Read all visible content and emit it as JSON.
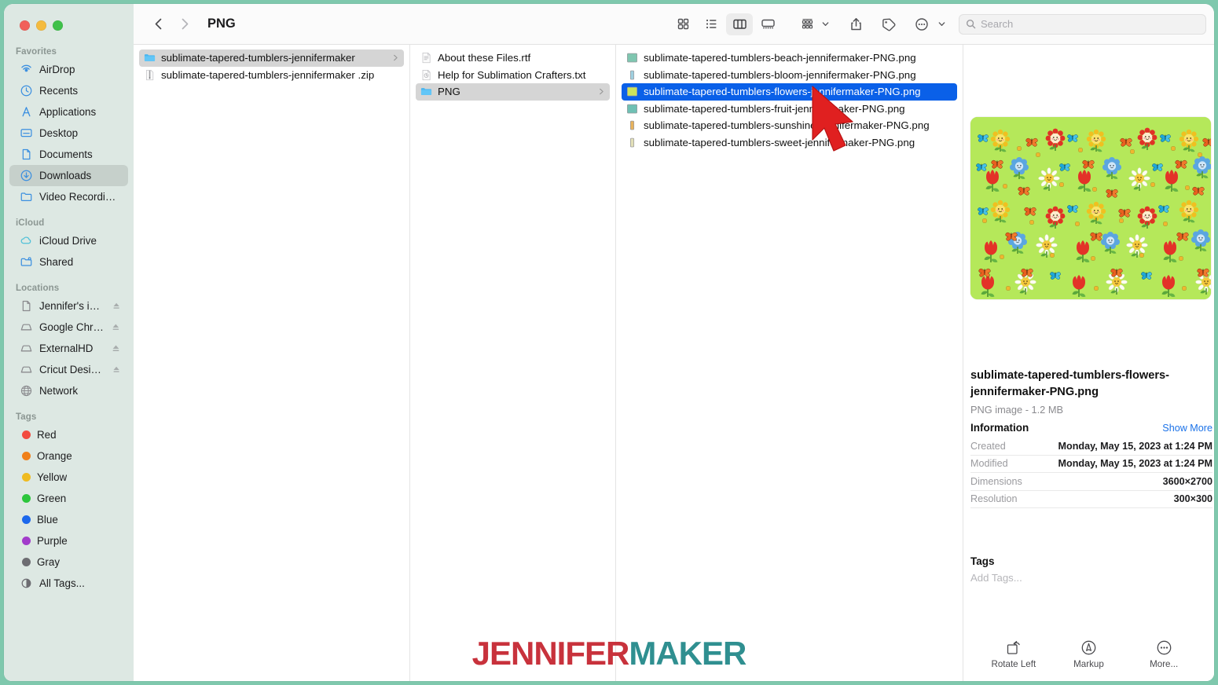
{
  "window": {
    "title": "PNG",
    "traffic_lights": [
      "close-red",
      "minimize-yellow",
      "zoom-green"
    ]
  },
  "toolbar": {
    "back_icon": "chevron-left-icon",
    "forward_icon": "chevron-right-icon",
    "path_title": "PNG",
    "views": [
      {
        "name": "icon-view",
        "icon": "grid-icon",
        "active": false
      },
      {
        "name": "list-view",
        "icon": "list-icon",
        "active": false
      },
      {
        "name": "column-view",
        "icon": "columns-icon",
        "active": true
      },
      {
        "name": "gallery-view",
        "icon": "gallery-icon",
        "active": false
      }
    ],
    "group_icon": "group-by-icon",
    "share_icon": "share-icon",
    "tag_icon": "tag-icon",
    "more_icon": "more-ellipsis-icon"
  },
  "search": {
    "placeholder": "Search",
    "value": "",
    "icon": "search-icon"
  },
  "sidebar": {
    "sections": [
      {
        "label": "Favorites",
        "items": [
          {
            "label": "AirDrop",
            "icon": "airdrop-icon",
            "selected": false
          },
          {
            "label": "Recents",
            "icon": "clock-icon",
            "selected": false
          },
          {
            "label": "Applications",
            "icon": "applications-icon",
            "selected": false
          },
          {
            "label": "Desktop",
            "icon": "desktop-icon",
            "selected": false
          },
          {
            "label": "Documents",
            "icon": "document-icon",
            "selected": false
          },
          {
            "label": "Downloads",
            "icon": "downloads-icon",
            "selected": true
          },
          {
            "label": "Video Recordings",
            "icon": "folder-icon",
            "selected": false
          }
        ]
      },
      {
        "label": "iCloud",
        "items": [
          {
            "label": "iCloud Drive",
            "icon": "cloud-icon",
            "selected": false
          },
          {
            "label": "Shared",
            "icon": "shared-folder-icon",
            "selected": false
          }
        ]
      },
      {
        "label": "Locations",
        "items": [
          {
            "label": "Jennifer's iPh...",
            "icon": "iphone-icon",
            "eject": true,
            "selected": false
          },
          {
            "label": "Google Chro...",
            "icon": "disk-icon",
            "eject": true,
            "selected": false
          },
          {
            "label": "ExternalHD",
            "icon": "disk-icon",
            "eject": true,
            "selected": false
          },
          {
            "label": "Cricut Design...",
            "icon": "disk-icon",
            "eject": true,
            "selected": false
          },
          {
            "label": "Network",
            "icon": "globe-icon",
            "eject": false,
            "selected": false
          }
        ]
      },
      {
        "label": "Tags",
        "items": [
          {
            "label": "Red",
            "color": "#f24b3f",
            "icon": "tag-dot-icon"
          },
          {
            "label": "Orange",
            "color": "#f08019",
            "icon": "tag-dot-icon"
          },
          {
            "label": "Yellow",
            "color": "#efbb21",
            "icon": "tag-dot-icon"
          },
          {
            "label": "Green",
            "color": "#2cc63c",
            "icon": "tag-dot-icon"
          },
          {
            "label": "Blue",
            "color": "#1c68ec",
            "icon": "tag-dot-icon"
          },
          {
            "label": "Purple",
            "color": "#a23ccb",
            "icon": "tag-dot-icon"
          },
          {
            "label": "Gray",
            "color": "#6d6d72",
            "icon": "tag-dot-icon"
          },
          {
            "label": "All Tags...",
            "icon": "all-tags-icon"
          }
        ]
      }
    ]
  },
  "columns": [
    {
      "name": "column-1",
      "items": [
        {
          "label": "sublimate-tapered-tumblers-jennifermaker",
          "icon": "folder-icon",
          "selected": true,
          "chevron": true
        },
        {
          "label": "sublimate-tapered-tumblers-jennifermaker .zip",
          "icon": "zip-icon",
          "selected": false,
          "chevron": false
        }
      ]
    },
    {
      "name": "column-2",
      "items": [
        {
          "label": "About these Files.rtf",
          "icon": "rtf-icon",
          "selected": false,
          "chevron": false
        },
        {
          "label": "Help for Sublimation Crafters.txt",
          "icon": "txt-icon",
          "selected": false,
          "chevron": false
        },
        {
          "label": "PNG",
          "icon": "folder-icon",
          "selected": true,
          "chevron": true
        }
      ]
    },
    {
      "name": "column-3",
      "items": [
        {
          "label": "sublimate-tapered-tumblers-beach-jennifermaker-PNG.png",
          "icon": "png-thumb-icon",
          "thumb": "#7fc6b0",
          "selected": false,
          "chevron": false,
          "wide": true
        },
        {
          "label": "sublimate-tapered-tumblers-bloom-jennifermaker-PNG.png",
          "icon": "png-thumb-icon",
          "thumb": "#9fd0e0",
          "selected": false,
          "chevron": false,
          "wide": false
        },
        {
          "label": "sublimate-tapered-tumblers-flowers-jennifermaker-PNG.png",
          "icon": "png-thumb-icon",
          "thumb": "#cbe45c",
          "selected": true,
          "chevron": false,
          "wide": true
        },
        {
          "label": "sublimate-tapered-tumblers-fruit-jennifermaker-PNG.png",
          "icon": "png-thumb-icon",
          "thumb": "#6fc0b4",
          "selected": false,
          "chevron": false,
          "wide": true
        },
        {
          "label": "sublimate-tapered-tumblers-sunshine-jennifermaker-PNG.png",
          "icon": "png-thumb-icon",
          "thumb": "#e8b35c",
          "selected": false,
          "chevron": false,
          "wide": false
        },
        {
          "label": "sublimate-tapered-tumblers-sweet-jennifermaker-PNG.png",
          "icon": "png-thumb-icon",
          "thumb": "#e3e0b8",
          "selected": false,
          "chevron": false,
          "wide": false
        }
      ]
    }
  ],
  "preview": {
    "thumbnail_alt": "green floral pattern with kawaii flowers and butterflies",
    "thumbnail_bg": "#b5e85a",
    "filename": "sublimate-tapered-tumblers-flowers-jennifermaker-PNG.png",
    "kind_and_size": "PNG image - 1.2 MB",
    "information_label": "Information",
    "show_more_label": "Show More",
    "rows": [
      {
        "key": "Created",
        "value": "Monday, May 15, 2023 at 1:24 PM"
      },
      {
        "key": "Modified",
        "value": "Monday, May 15, 2023 at 1:24 PM"
      },
      {
        "key": "Dimensions",
        "value": "3600×2700"
      },
      {
        "key": "Resolution",
        "value": "300×300"
      }
    ],
    "tags_label": "Tags",
    "add_tags_placeholder": "Add Tags...",
    "actions": [
      {
        "label": "Rotate Left",
        "icon": "rotate-left-icon"
      },
      {
        "label": "Markup",
        "icon": "markup-icon"
      },
      {
        "label": "More...",
        "icon": "more-ellipsis-icon"
      }
    ]
  },
  "watermark": {
    "part1": "JENNIFER",
    "part2": "MAKER",
    "color1": "#c8323c",
    "color2": "#2f8f90"
  },
  "cursor": {
    "icon": "arrow-cursor-icon",
    "color": "#e02020"
  },
  "colors": {
    "selection_blue": "#0a60e8",
    "frame_teal": "#7fc8ad",
    "sidebar_bg": "#dde8e3",
    "link_blue": "#1b72e8"
  }
}
